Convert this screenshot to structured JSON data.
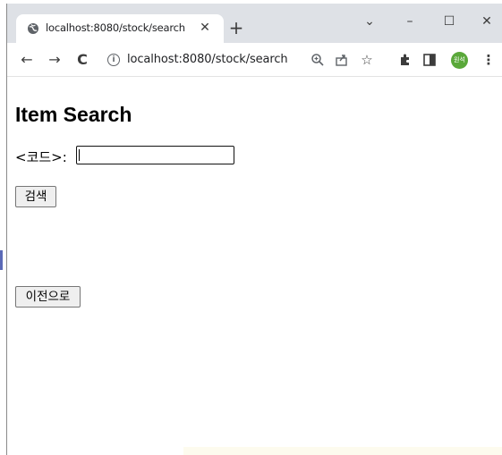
{
  "browser": {
    "tab": {
      "title": "localhost:8080/stock/search",
      "close_icon": "close-icon",
      "favicon": "globe-icon"
    },
    "new_tab_label": "+",
    "window_controls": {
      "tab_search": "⌄",
      "minimize": "–",
      "maximize": "☐",
      "close": "✕"
    },
    "toolbar": {
      "back": "←",
      "forward": "→",
      "reload": "C",
      "url": "localhost:8080/stock/search",
      "avatar_text": "원석"
    }
  },
  "page": {
    "title": "Item Search",
    "code_label": "<코드>:",
    "code_input_value": "",
    "search_button": "검색",
    "back_button": "이전으로"
  },
  "colors": {
    "titlebar": "#dee1e6",
    "avatar": "#5aa83a"
  }
}
